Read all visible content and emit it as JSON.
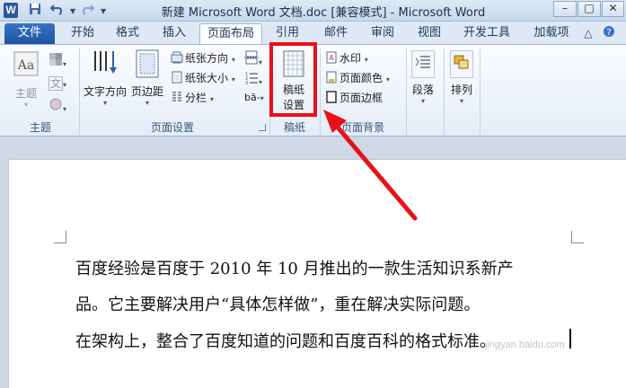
{
  "window": {
    "title": "新建 Microsoft Word 文档.doc [兼容模式] - Microsoft Word",
    "app_icon_letter": "W"
  },
  "quick_access": {
    "save_icon": "save-icon",
    "undo_icon": "undo-icon",
    "redo_icon": "redo-icon",
    "customize_icon": "qat-dropdown-icon"
  },
  "window_controls": {
    "minimize": "–",
    "maximize": "□",
    "close": "✕"
  },
  "tabs": [
    {
      "label": "文件"
    },
    {
      "label": "开始"
    },
    {
      "label": "格式"
    },
    {
      "label": "插入"
    },
    {
      "label": "页面布局"
    },
    {
      "label": "引用"
    },
    {
      "label": "邮件"
    },
    {
      "label": "审阅"
    },
    {
      "label": "视图"
    },
    {
      "label": "开发工具"
    },
    {
      "label": "加载项"
    }
  ],
  "ribbon": {
    "theme_group": {
      "label": "主题",
      "themes_button": "主题",
      "colors_icon": "theme-colors-icon",
      "fonts_label": "文",
      "effects_icon": "theme-effects-icon"
    },
    "page_setup_group": {
      "label": "页面设置",
      "text_direction": "文字方向",
      "margins": "页边距",
      "orientation": "纸张方向",
      "size": "纸张大小",
      "columns": "分栏",
      "breaks_icon": "breaks-icon",
      "line_numbers_icon": "line-numbers-icon",
      "hyphenation_label": "bā-"
    },
    "manuscript_group": {
      "label": "稿纸",
      "button_line1": "稿纸",
      "button_line2": "设置"
    },
    "page_background_group": {
      "label": "页面背景",
      "watermark": "水印",
      "page_color": "页面颜色",
      "page_borders": "页面边框"
    },
    "paragraph_button": "段落",
    "arrange_button": "排列"
  },
  "document": {
    "lines": [
      "百度经验是百度于 2010 年 10 月推出的一款生活知识系新产",
      "品。它主要解决用户“具体怎样做”，重在解决实际问题。",
      "在架构上，整合了百度知道的问题和百度百科的格式标准。"
    ]
  },
  "watermark_text": "jingyan.baidu.com",
  "colors": {
    "highlight_box": "#e8101a",
    "annotation_arrow": "#e8101a",
    "file_tab": "#2b5faf"
  }
}
